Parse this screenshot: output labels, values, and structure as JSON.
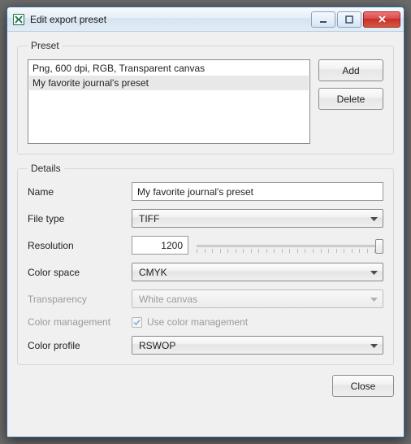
{
  "window": {
    "title": "Edit export preset"
  },
  "preset_group": {
    "legend": "Preset",
    "items": [
      {
        "label": "Png, 600 dpi, RGB, Transparent canvas",
        "selected": false
      },
      {
        "label": "My favorite journal's preset",
        "selected": true
      }
    ],
    "add_label": "Add",
    "delete_label": "Delete"
  },
  "details_group": {
    "legend": "Details",
    "name": {
      "label": "Name",
      "value": "My favorite journal's preset"
    },
    "file_type": {
      "label": "File type",
      "value": "TIFF"
    },
    "resolution": {
      "label": "Resolution",
      "value": "1200",
      "min": 0,
      "max": 1200,
      "ticks": 25,
      "thumb_pct": 98
    },
    "color_space": {
      "label": "Color space",
      "value": "CMYK"
    },
    "transparency": {
      "label": "Transparency",
      "value": "White canvas",
      "disabled": true
    },
    "color_management": {
      "label": "Color management",
      "checkbox_label": "Use color management",
      "checked": true,
      "disabled": true
    },
    "color_profile": {
      "label": "Color profile",
      "value": "RSWOP"
    }
  },
  "footer": {
    "close_label": "Close"
  }
}
